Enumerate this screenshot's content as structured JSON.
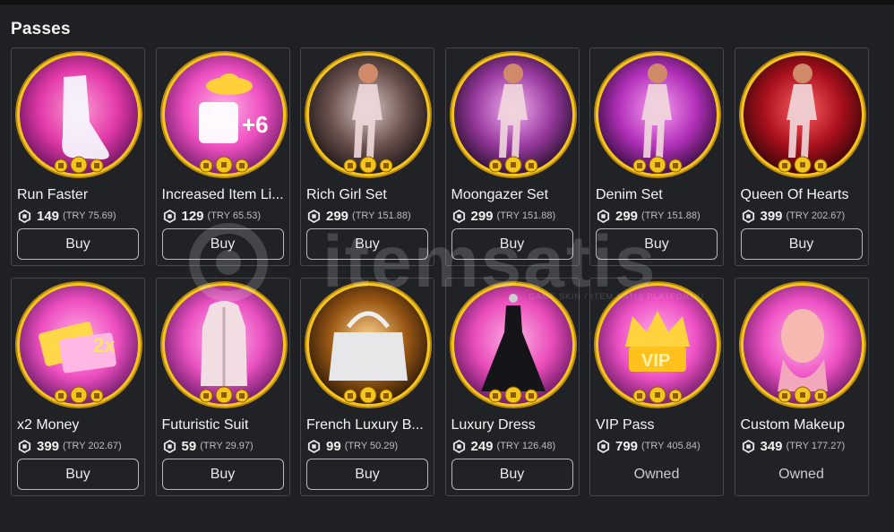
{
  "section": {
    "title": "Passes"
  },
  "passes": [
    {
      "name": "Run Faster",
      "price": "149",
      "local": "(TRY 75.69)",
      "action": "Buy",
      "owned": false,
      "art": "shoe-icon"
    },
    {
      "name": "Increased Item Li...",
      "price": "129",
      "local": "(TRY 65.53)",
      "action": "Buy",
      "owned": false,
      "art": "clothes-plus-icon"
    },
    {
      "name": "Rich Girl Set",
      "price": "299",
      "local": "(TRY 151.88)",
      "action": "Buy",
      "owned": false,
      "art": "avatar-outfit-icon"
    },
    {
      "name": "Moongazer Set",
      "price": "299",
      "local": "(TRY 151.88)",
      "action": "Buy",
      "owned": false,
      "art": "avatar-outfit-icon"
    },
    {
      "name": "Denim Set",
      "price": "299",
      "local": "(TRY 151.88)",
      "action": "Buy",
      "owned": false,
      "art": "avatar-outfit-icon"
    },
    {
      "name": "Queen Of Hearts",
      "price": "399",
      "local": "(TRY 202.67)",
      "action": "Buy",
      "owned": false,
      "art": "avatar-outfit-icon"
    },
    {
      "name": "x2 Money",
      "price": "399",
      "local": "(TRY 202.67)",
      "action": "Buy",
      "owned": false,
      "art": "money-icon"
    },
    {
      "name": "Futuristic Suit",
      "price": "59",
      "local": "(TRY 29.97)",
      "action": "Buy",
      "owned": false,
      "art": "suit-icon"
    },
    {
      "name": "French Luxury B...",
      "price": "99",
      "local": "(TRY 50.29)",
      "action": "Buy",
      "owned": false,
      "art": "handbag-icon"
    },
    {
      "name": "Luxury Dress",
      "price": "249",
      "local": "(TRY 126.48)",
      "action": "Buy",
      "owned": false,
      "art": "dress-icon"
    },
    {
      "name": "VIP Pass",
      "price": "799",
      "local": "(TRY 405.84)",
      "action": "Owned",
      "owned": true,
      "art": "vip-crown-icon"
    },
    {
      "name": "Custom Makeup",
      "price": "349",
      "local": "(TRY 177.27)",
      "action": "Owned",
      "owned": true,
      "art": "makeup-face-icon"
    }
  ],
  "watermark": {
    "text": "itemsatis",
    "subtext": "GAME SKIN / ITEM SATIŞ PLATFORMU"
  },
  "colors": {
    "background": "#1f2023",
    "card_border": "#45474c",
    "ring_gold": "#f3c21b"
  }
}
